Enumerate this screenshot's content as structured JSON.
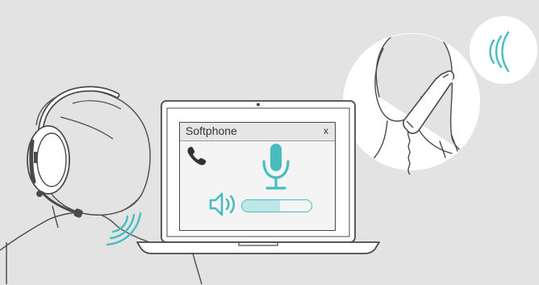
{
  "softphone": {
    "title": "Softphone",
    "close_label": "x"
  },
  "volume": {
    "level": 0.55
  },
  "icons": {
    "phone": "phone-icon",
    "microphone": "microphone-icon",
    "speaker": "speaker-icon",
    "sound_waves_headset": "sound-waves-icon",
    "sound_waves_bubble": "sound-waves-icon"
  },
  "colors": {
    "background": "#e3e3e3",
    "accent": "#48bcbf",
    "accent_light": "#bfe6e7",
    "line": "#4a4a4a"
  }
}
